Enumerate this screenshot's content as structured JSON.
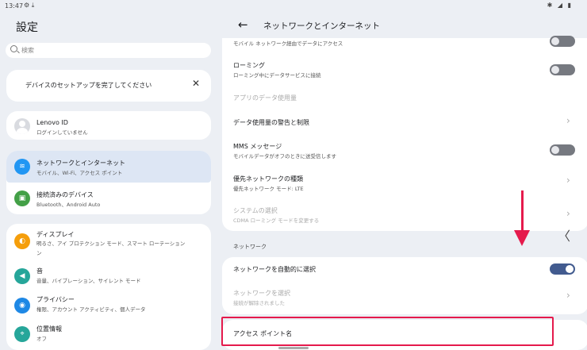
{
  "statusbar": {
    "time": "13:47",
    "left_icons": "⚙ ⤓",
    "right_icons": "✱ ◢ ▮"
  },
  "left": {
    "title": "設定",
    "search_placeholder": "検索",
    "setup_card": {
      "text": "デバイスのセットアップを完了してください",
      "close": "✕"
    },
    "account": {
      "title": "Lenovo ID",
      "subtitle": "ログインしていません"
    },
    "items": [
      {
        "title": "ネットワークとインターネット",
        "subtitle": "モバイル、Wi-Fi、アクセス ポイント",
        "icon": "wifi-icon",
        "color": "#2196f3",
        "glyph": "≋"
      },
      {
        "title": "接続済みのデバイス",
        "subtitle": "Bluetooth、Android Auto",
        "icon": "connected-devices-icon",
        "color": "#43a047",
        "glyph": "▣"
      },
      {
        "title": "ディスプレイ",
        "subtitle": "明るさ、アイ プロテクション モード、スマート ローテーション",
        "subtitle2": "ン",
        "icon": "display-icon",
        "color": "#f59e0b",
        "glyph": "◐"
      },
      {
        "title": "音",
        "subtitle": "音量、バイブレーション、サイレント モード",
        "icon": "sound-icon",
        "color": "#26a69a",
        "glyph": "◀"
      },
      {
        "title": "プライバシー",
        "subtitle": "権限、アカウント アクティビティ、個人データ",
        "icon": "privacy-icon",
        "color": "#1e88e5",
        "glyph": "◉"
      },
      {
        "title": "位置情報",
        "subtitle": "オフ",
        "icon": "location-icon",
        "color": "#26a69a",
        "glyph": "⌖"
      }
    ]
  },
  "right": {
    "back": "←",
    "title": "ネットワークとインターネット",
    "rows": [
      {
        "subtitle": "モバイル ネットワーク経由でデータにアクセス"
      },
      {
        "title": "ローミング",
        "subtitle": "ローミング中にデータサービスに接続"
      },
      {
        "title": "アプリのデータ使用量"
      },
      {
        "title": "データ使用量の警告と制限"
      },
      {
        "title": "MMS メッセージ",
        "subtitle": "モバイルデータがオフのときに送受信します"
      },
      {
        "title": "優先ネットワークの種類",
        "subtitle": "優先ネットワーク モード: LTE"
      },
      {
        "title": "システムの選択",
        "subtitle": "CDMA ローミング モードを変更する"
      }
    ],
    "section_label": "ネットワーク",
    "network_rows": [
      {
        "title": "ネットワークを自動的に選択"
      },
      {
        "title": "ネットワークを選択",
        "subtitle": "接続が解除されました"
      }
    ],
    "apn": {
      "title": "アクセス ポイント名"
    },
    "chevron": "›",
    "side_chevron": "〈"
  }
}
